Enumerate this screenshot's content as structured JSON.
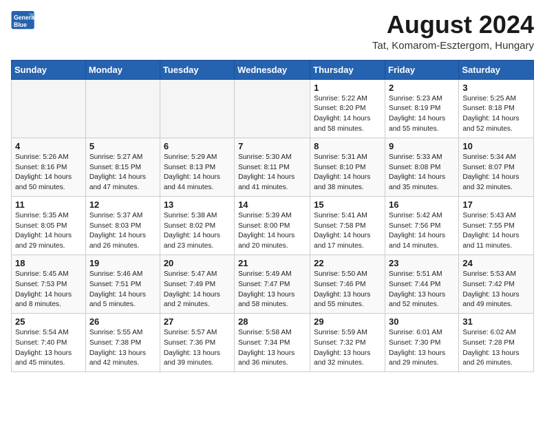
{
  "logo": {
    "line1": "General",
    "line2": "Blue"
  },
  "title": "August 2024",
  "location": "Tat, Komarom-Esztergom, Hungary",
  "days_header": [
    "Sunday",
    "Monday",
    "Tuesday",
    "Wednesday",
    "Thursday",
    "Friday",
    "Saturday"
  ],
  "weeks": [
    [
      {
        "day": "",
        "info": ""
      },
      {
        "day": "",
        "info": ""
      },
      {
        "day": "",
        "info": ""
      },
      {
        "day": "",
        "info": ""
      },
      {
        "day": "1",
        "info": "Sunrise: 5:22 AM\nSunset: 8:20 PM\nDaylight: 14 hours\nand 58 minutes."
      },
      {
        "day": "2",
        "info": "Sunrise: 5:23 AM\nSunset: 8:19 PM\nDaylight: 14 hours\nand 55 minutes."
      },
      {
        "day": "3",
        "info": "Sunrise: 5:25 AM\nSunset: 8:18 PM\nDaylight: 14 hours\nand 52 minutes."
      }
    ],
    [
      {
        "day": "4",
        "info": "Sunrise: 5:26 AM\nSunset: 8:16 PM\nDaylight: 14 hours\nand 50 minutes."
      },
      {
        "day": "5",
        "info": "Sunrise: 5:27 AM\nSunset: 8:15 PM\nDaylight: 14 hours\nand 47 minutes."
      },
      {
        "day": "6",
        "info": "Sunrise: 5:29 AM\nSunset: 8:13 PM\nDaylight: 14 hours\nand 44 minutes."
      },
      {
        "day": "7",
        "info": "Sunrise: 5:30 AM\nSunset: 8:11 PM\nDaylight: 14 hours\nand 41 minutes."
      },
      {
        "day": "8",
        "info": "Sunrise: 5:31 AM\nSunset: 8:10 PM\nDaylight: 14 hours\nand 38 minutes."
      },
      {
        "day": "9",
        "info": "Sunrise: 5:33 AM\nSunset: 8:08 PM\nDaylight: 14 hours\nand 35 minutes."
      },
      {
        "day": "10",
        "info": "Sunrise: 5:34 AM\nSunset: 8:07 PM\nDaylight: 14 hours\nand 32 minutes."
      }
    ],
    [
      {
        "day": "11",
        "info": "Sunrise: 5:35 AM\nSunset: 8:05 PM\nDaylight: 14 hours\nand 29 minutes."
      },
      {
        "day": "12",
        "info": "Sunrise: 5:37 AM\nSunset: 8:03 PM\nDaylight: 14 hours\nand 26 minutes."
      },
      {
        "day": "13",
        "info": "Sunrise: 5:38 AM\nSunset: 8:02 PM\nDaylight: 14 hours\nand 23 minutes."
      },
      {
        "day": "14",
        "info": "Sunrise: 5:39 AM\nSunset: 8:00 PM\nDaylight: 14 hours\nand 20 minutes."
      },
      {
        "day": "15",
        "info": "Sunrise: 5:41 AM\nSunset: 7:58 PM\nDaylight: 14 hours\nand 17 minutes."
      },
      {
        "day": "16",
        "info": "Sunrise: 5:42 AM\nSunset: 7:56 PM\nDaylight: 14 hours\nand 14 minutes."
      },
      {
        "day": "17",
        "info": "Sunrise: 5:43 AM\nSunset: 7:55 PM\nDaylight: 14 hours\nand 11 minutes."
      }
    ],
    [
      {
        "day": "18",
        "info": "Sunrise: 5:45 AM\nSunset: 7:53 PM\nDaylight: 14 hours\nand 8 minutes."
      },
      {
        "day": "19",
        "info": "Sunrise: 5:46 AM\nSunset: 7:51 PM\nDaylight: 14 hours\nand 5 minutes."
      },
      {
        "day": "20",
        "info": "Sunrise: 5:47 AM\nSunset: 7:49 PM\nDaylight: 14 hours\nand 2 minutes."
      },
      {
        "day": "21",
        "info": "Sunrise: 5:49 AM\nSunset: 7:47 PM\nDaylight: 13 hours\nand 58 minutes."
      },
      {
        "day": "22",
        "info": "Sunrise: 5:50 AM\nSunset: 7:46 PM\nDaylight: 13 hours\nand 55 minutes."
      },
      {
        "day": "23",
        "info": "Sunrise: 5:51 AM\nSunset: 7:44 PM\nDaylight: 13 hours\nand 52 minutes."
      },
      {
        "day": "24",
        "info": "Sunrise: 5:53 AM\nSunset: 7:42 PM\nDaylight: 13 hours\nand 49 minutes."
      }
    ],
    [
      {
        "day": "25",
        "info": "Sunrise: 5:54 AM\nSunset: 7:40 PM\nDaylight: 13 hours\nand 45 minutes."
      },
      {
        "day": "26",
        "info": "Sunrise: 5:55 AM\nSunset: 7:38 PM\nDaylight: 13 hours\nand 42 minutes."
      },
      {
        "day": "27",
        "info": "Sunrise: 5:57 AM\nSunset: 7:36 PM\nDaylight: 13 hours\nand 39 minutes."
      },
      {
        "day": "28",
        "info": "Sunrise: 5:58 AM\nSunset: 7:34 PM\nDaylight: 13 hours\nand 36 minutes."
      },
      {
        "day": "29",
        "info": "Sunrise: 5:59 AM\nSunset: 7:32 PM\nDaylight: 13 hours\nand 32 minutes."
      },
      {
        "day": "30",
        "info": "Sunrise: 6:01 AM\nSunset: 7:30 PM\nDaylight: 13 hours\nand 29 minutes."
      },
      {
        "day": "31",
        "info": "Sunrise: 6:02 AM\nSunset: 7:28 PM\nDaylight: 13 hours\nand 26 minutes."
      }
    ]
  ]
}
